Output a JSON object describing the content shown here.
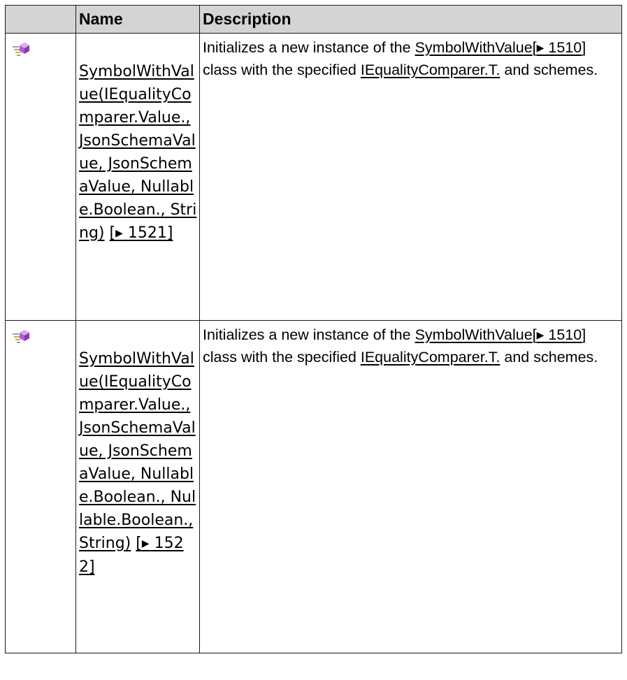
{
  "table": {
    "headers": {
      "icon": "",
      "name": "Name",
      "description": "Description"
    },
    "rows": [
      {
        "icon": "public-method-icon",
        "name": {
          "text": "SymbolWithValue(IEqualityComparer.Value., JsonSchemaValue, JsonSchemaValue, Nullable.Boolean., String)",
          "page_ref_open": "[",
          "page_ref_arrow": "▶",
          "page_ref_page": " 1521",
          "page_ref_close": "]"
        },
        "description": {
          "prefix": "Initializes a new instance of the ",
          "class_link": "SymbolWithValue",
          "class_ref_open": "[",
          "class_ref_arrow": "▶",
          "class_ref_page": " 1510",
          "class_ref_close": "]",
          "middle": " class with the specified ",
          "type_link": "IEqualityComparer.T.",
          "suffix": " and schemes."
        }
      },
      {
        "icon": "public-method-icon",
        "name": {
          "text": "SymbolWithValue(IEqualityComparer.Value., JsonSchemaValue, JsonSchemaValue, Nullable.Boolean., Nullable.Boolean., String)",
          "page_ref_open": "[",
          "page_ref_arrow": "▶",
          "page_ref_page": " 1522",
          "page_ref_close": "]"
        },
        "description": {
          "prefix": "Initializes a new instance of the ",
          "class_link": "SymbolWithValue",
          "class_ref_open": "[",
          "class_ref_arrow": "▶",
          "class_ref_page": " 1510",
          "class_ref_close": "]",
          "middle": " class with the specified ",
          "type_link": "IEqualityComparer.T.",
          "suffix": " and schemes."
        }
      }
    ]
  },
  "colors": {
    "header_background": "#d4d4d4",
    "border": "#1a1a1a",
    "text": "#000000",
    "icon_gem": "#b05bd0",
    "icon_bars": "#c8b040"
  }
}
